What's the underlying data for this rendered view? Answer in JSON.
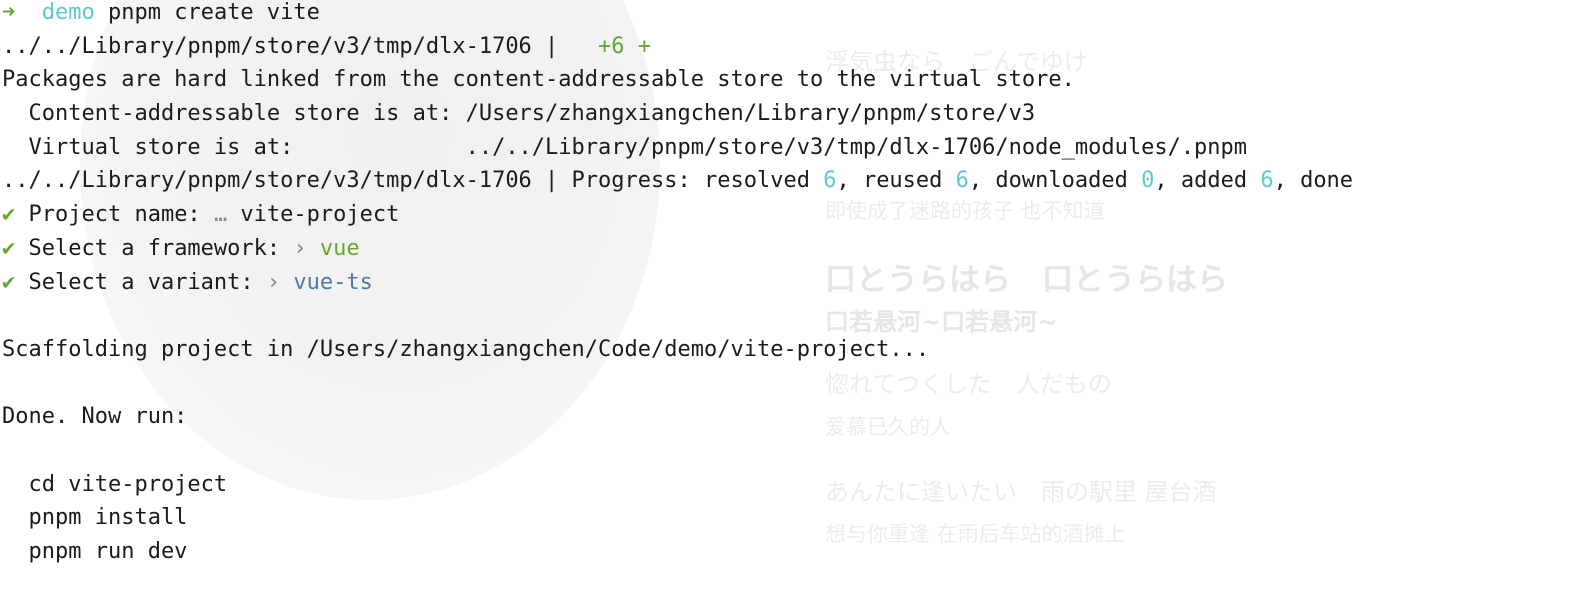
{
  "terminal": {
    "prompt": {
      "arrow": "➜",
      "dir": "demo",
      "command": "pnpm create vite"
    },
    "dlx_line": {
      "path": "../../Library/pnpm/store/v3/tmp/dlx-1706 |",
      "change": "+6 +"
    },
    "hardlink_line": "Packages are hard linked from the content-addressable store to the virtual store.",
    "cas_line": "  Content-addressable store is at: /Users/zhangxiangchen/Library/pnpm/store/v3",
    "virtual_line": "  Virtual store is at:             ../../Library/pnpm/store/v3/tmp/dlx-1706/node_modules/.pnpm",
    "progress": {
      "prefix": "../../Library/pnpm/store/v3/tmp/dlx-1706 | Progress: resolved ",
      "resolved": "6",
      "reused_label": ", reused ",
      "reused": "6",
      "downloaded_label": ", downloaded ",
      "downloaded": "0",
      "added_label": ", added ",
      "added": "6",
      "done_label": ", done"
    },
    "questions": [
      {
        "check": "✔",
        "label": " Project name: ",
        "sep": "…",
        "answer": " vite-project"
      },
      {
        "check": "✔",
        "label": " Select a framework: ",
        "sep": "›",
        "answer": " vue"
      },
      {
        "check": "✔",
        "label": " Select a variant: ",
        "sep": "›",
        "answer": " vue-ts"
      }
    ],
    "scaffolding_line": "Scaffolding project in /Users/zhangxiangchen/Code/demo/vite-project...",
    "done_line": "Done. Now run:",
    "next_steps": [
      "  cd vite-project",
      "  pnpm install",
      "  pnpm run dev"
    ]
  },
  "background": {
    "lyrics": [
      "浮気虫なら　ごんでゆけ",
      "即使成了迷路的孩子 也不知道",
      "口とうらはら　口とうらはら",
      "口若悬河~口若悬河~",
      "惚れてつくした　人だもの",
      "爱慕已久的人",
      "あんたに逢いたい　雨の駅里 屋台酒",
      "想与你重逢 在雨后车站的酒摊上"
    ]
  },
  "colors": {
    "green": "#67a633",
    "cyan": "#5ec9cf",
    "blue": "#4f79a8",
    "text": "#1b1b1b"
  }
}
